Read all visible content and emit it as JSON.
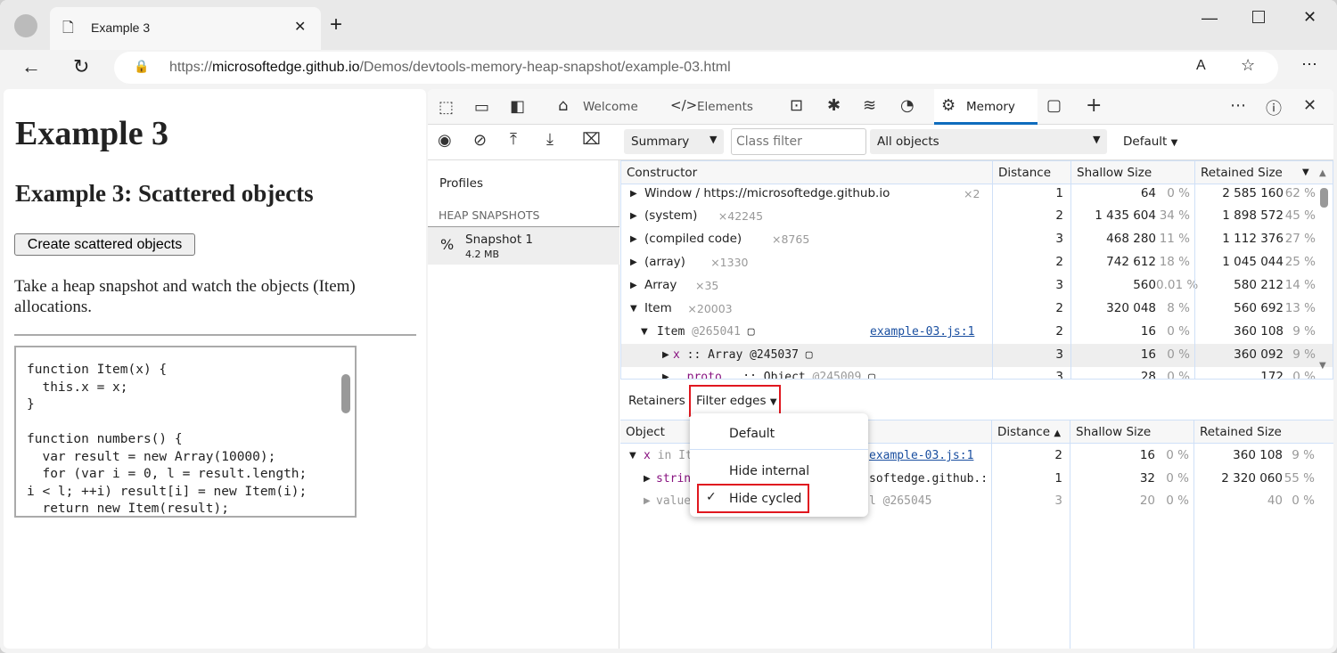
{
  "browser": {
    "tab_title": "Example 3",
    "url_prefix": "https://",
    "url_host": "microsoftedge.github.io",
    "url_path": "/Demos/devtools-memory-heap-snapshot/example-03.html"
  },
  "page": {
    "h1": "Example 3",
    "h2": "Example 3: Scattered objects",
    "button": "Create scattered objects",
    "paragraph": "Take a heap snapshot and watch the objects (Item) allocations.",
    "code": "function Item(x) {\n  this.x = x;\n}\n\nfunction numbers() {\n  var result = new Array(10000);\n  for (var i = 0, l = result.length;\ni < l; ++i) result[i] = new Item(i);\n  return new Item(result);"
  },
  "devtools": {
    "tabs": [
      "Welcome",
      "Elements",
      "Memory"
    ],
    "active_tab": "Memory",
    "toolbar": {
      "view": "Summary",
      "class_filter_placeholder": "Class filter",
      "objects": "All objects",
      "default": "Default"
    },
    "sidebar": {
      "profiles": "Profiles",
      "section": "HEAP SNAPSHOTS",
      "snapshot_name": "Snapshot 1",
      "snapshot_size": "4.2 MB"
    },
    "columns": {
      "constructor": "Constructor",
      "distance": "Distance",
      "shallow": "Shallow Size",
      "retained": "Retained Size"
    },
    "rows": [
      {
        "name": "Window / https://microsoftedge.github.io",
        "count": "×2",
        "distance": "1",
        "shallow": "64",
        "shallow_pct": "0 %",
        "retained": "2 585 160",
        "retained_pct": "62 %",
        "indent": 0,
        "open": false
      },
      {
        "name": "(system)",
        "count": "×42245",
        "distance": "2",
        "shallow": "1 435 604",
        "shallow_pct": "34 %",
        "retained": "1 898 572",
        "retained_pct": "45 %",
        "indent": 0,
        "open": false
      },
      {
        "name": "(compiled code)",
        "count": "×8765",
        "distance": "3",
        "shallow": "468 280",
        "shallow_pct": "11 %",
        "retained": "1 112 376",
        "retained_pct": "27 %",
        "indent": 0,
        "open": false
      },
      {
        "name": "(array)",
        "count": "×1330",
        "distance": "2",
        "shallow": "742 612",
        "shallow_pct": "18 %",
        "retained": "1 045 044",
        "retained_pct": "25 %",
        "indent": 0,
        "open": false
      },
      {
        "name": "Array",
        "count": "×35",
        "distance": "3",
        "shallow": "560",
        "shallow_pct": "0.01 %",
        "retained": "580 212",
        "retained_pct": "14 %",
        "indent": 0,
        "open": false
      },
      {
        "name": "Item",
        "count": "×20003",
        "distance": "2",
        "shallow": "320 048",
        "shallow_pct": "8 %",
        "retained": "560 692",
        "retained_pct": "13 %",
        "indent": 0,
        "open": true
      }
    ],
    "item_row": {
      "name": "Item",
      "id": "@265041",
      "link": "example-03.js:1",
      "distance": "2",
      "shallow": "16",
      "shallow_pct": "0 %",
      "retained": "360 108",
      "retained_pct": "9 %"
    },
    "x_row": {
      "prop": "x",
      "sep": " :: Array ",
      "id": "@245037",
      "distance": "3",
      "shallow": "16",
      "shallow_pct": "0 %",
      "retained": "360 092",
      "retained_pct": "9 %"
    },
    "proto_row": {
      "prop": "__proto__",
      "sep": " :: Object ",
      "id": "@245009",
      "distance": "3",
      "shallow": "28",
      "shallow_pct": "0 %",
      "retained": "172",
      "retained_pct": "0 %"
    },
    "retainers": {
      "label": "Retainers",
      "filter": "Filter edges",
      "columns": {
        "object": "Object",
        "distance": "Distance",
        "shallow": "Shallow Size",
        "retained": "Retained Size"
      },
      "rows": [
        {
          "a": "x",
          "b": " in It",
          "tail": "example-03.js:1",
          "distance": "2",
          "shallow": "16",
          "shallow_pct": "0 %",
          "retained": "360 108",
          "retained_pct": "9 %"
        },
        {
          "a": "strin",
          "b": "",
          "tail": "softedge.github.:",
          "distance": "1",
          "shallow": "32",
          "shallow_pct": "0 %",
          "retained": "2 320 060",
          "retained_pct": "55 %"
        },
        {
          "a": "value",
          "b": "",
          "tail": "l @265045",
          "distance": "3",
          "shallow": "20",
          "shallow_pct": "0 %",
          "retained": "40",
          "retained_pct": "0 %"
        }
      ]
    },
    "menu": {
      "items": [
        "Default",
        "Hide internal",
        "Hide cycled"
      ],
      "checked": "Hide cycled"
    }
  }
}
